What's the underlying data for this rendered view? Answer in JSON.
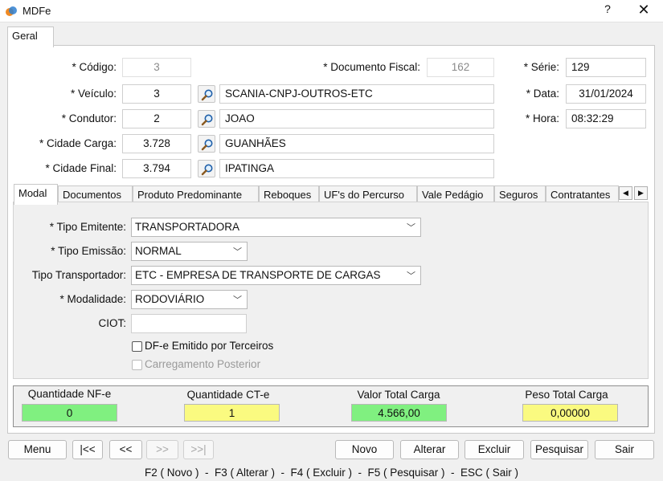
{
  "window": {
    "title": "MDFe",
    "help_label": "?",
    "close_label": "✕"
  },
  "top_tab": {
    "label": "Geral"
  },
  "form": {
    "codigo": {
      "label": "* Código:",
      "value": "3"
    },
    "documento_fiscal": {
      "label": "* Documento Fiscal:",
      "value": "162"
    },
    "serie": {
      "label": "* Série:",
      "value": "129"
    },
    "veiculo": {
      "label": "* Veículo:",
      "code": "3",
      "description": "SCANIA-CNPJ-OUTROS-ETC"
    },
    "data": {
      "label": "* Data:",
      "value": "31/01/2024"
    },
    "condutor": {
      "label": "* Condutor:",
      "code": "2",
      "description": "JOAO"
    },
    "hora": {
      "label": "* Hora:",
      "value": "08:32:29"
    },
    "cidade_carga": {
      "label": "* Cidade Carga:",
      "code": "3.728",
      "description": "GUANHÃES"
    },
    "cidade_final": {
      "label": "* Cidade Final:",
      "code": "3.794",
      "description": "IPATINGA"
    }
  },
  "inner_tabs": [
    "Modal",
    "Documentos",
    "Produto Predominante",
    "Reboques",
    "UF's do Percurso",
    "Vale Pedágio",
    "Seguros",
    "Contratantes"
  ],
  "scroll_left": "◀",
  "scroll_right": "▶",
  "modal": {
    "tipo_emitente": {
      "label": "* Tipo Emitente:",
      "value": "TRANSPORTADORA"
    },
    "tipo_emissao": {
      "label": "* Tipo Emissão:",
      "value": "NORMAL"
    },
    "tipo_transportador": {
      "label": "Tipo Transportador:",
      "value": "ETC - EMPRESA DE TRANSPORTE DE CARGAS"
    },
    "modalidade": {
      "label": "* Modalidade:",
      "value": "RODOVIÁRIO"
    },
    "ciot": {
      "label": "CIOT:",
      "value": ""
    },
    "dfe_terceiros": {
      "label": "DF-e Emitido por Terceiros",
      "checked": false
    },
    "carregamento_posterior": {
      "label": "Carregamento Posterior",
      "checked": false,
      "disabled": true
    }
  },
  "totals": {
    "qtd_nfe": {
      "label": "Quantidade NF-e",
      "value": "0",
      "color": "#80f080"
    },
    "qtd_cte": {
      "label": "Quantidade CT-e",
      "value": "1",
      "color": "#fafa80"
    },
    "valor_total": {
      "label": "Valor Total Carga",
      "value": "4.566,00",
      "color": "#80f080"
    },
    "peso_total": {
      "label": "Peso Total Carga",
      "value": "0,00000",
      "color": "#fafa80"
    }
  },
  "nav_buttons": {
    "menu": "Menu",
    "first": "|<<",
    "prev": "<<",
    "next": ">>",
    "last": ">>|"
  },
  "action_buttons": {
    "novo": "Novo",
    "alterar": "Alterar",
    "excluir": "Excluir",
    "pesquisar": "Pesquisar",
    "sair": "Sair"
  },
  "shortcuts": "F2 ( Novo )  -  F3 ( Alterar )  -  F4 ( Excluir )  -  F5 ( Pesquisar )  -  ESC ( Sair )"
}
